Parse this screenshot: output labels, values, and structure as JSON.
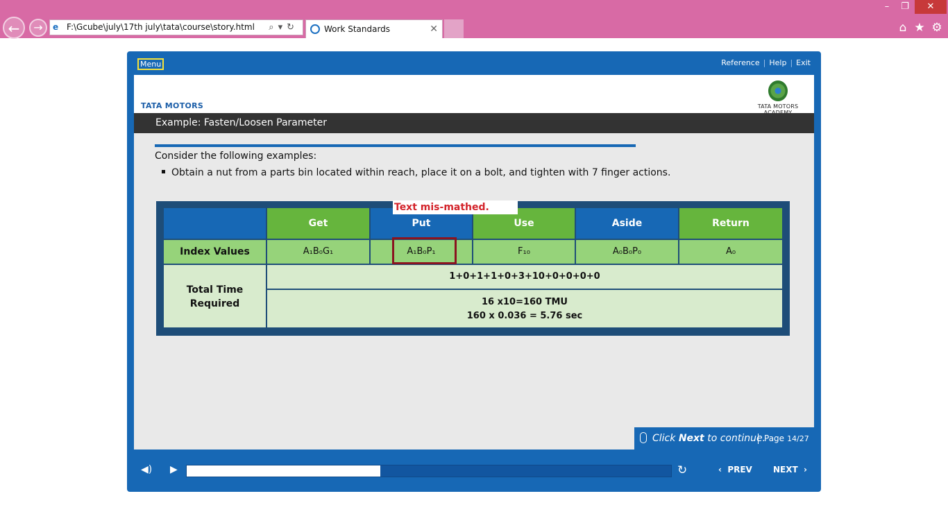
{
  "browser": {
    "address": "F:\\Gcube\\july\\17th july\\tata\\course\\story.html",
    "tab_title": "Work Standards"
  },
  "player": {
    "menu_label": "Menu",
    "links": [
      "Reference",
      "Help",
      "Exit"
    ],
    "brand": "TATA MOTORS",
    "academy": "TATA MOTORS ACADEMY",
    "slide_title": "Example: Fasten/Loosen Parameter",
    "intro": "Consider the following examples:",
    "bullet": "Obtain a nut from a parts bin located within reach, place it on a bolt, and tighten with 7 finger actions.",
    "annotation": "Text mis-mathed.",
    "table": {
      "headers": [
        "Get",
        "Put",
        "Use",
        "Aside",
        "Return"
      ],
      "index_label": "Index Values",
      "index_values": [
        "A₁B₀G₁",
        "A₁B₀P₁",
        "F₁₀",
        "A₀B₀P₀",
        "A₀"
      ],
      "total_label_1": "Total Time",
      "total_label_2": "Required",
      "sum": "1+0+1+1+0+3+10+0+0+0+0",
      "tmu": "16 x10=160 TMU",
      "sec": "160 x 0.036 = 5.76 sec"
    },
    "footer": {
      "msg_pre": "Click ",
      "msg_bold": "Next",
      "msg_post": " to continue.",
      "page_label": "Page",
      "page_num": "14/27"
    },
    "controls": {
      "progress": 0.4,
      "prev": "PREV",
      "next": "NEXT"
    }
  }
}
